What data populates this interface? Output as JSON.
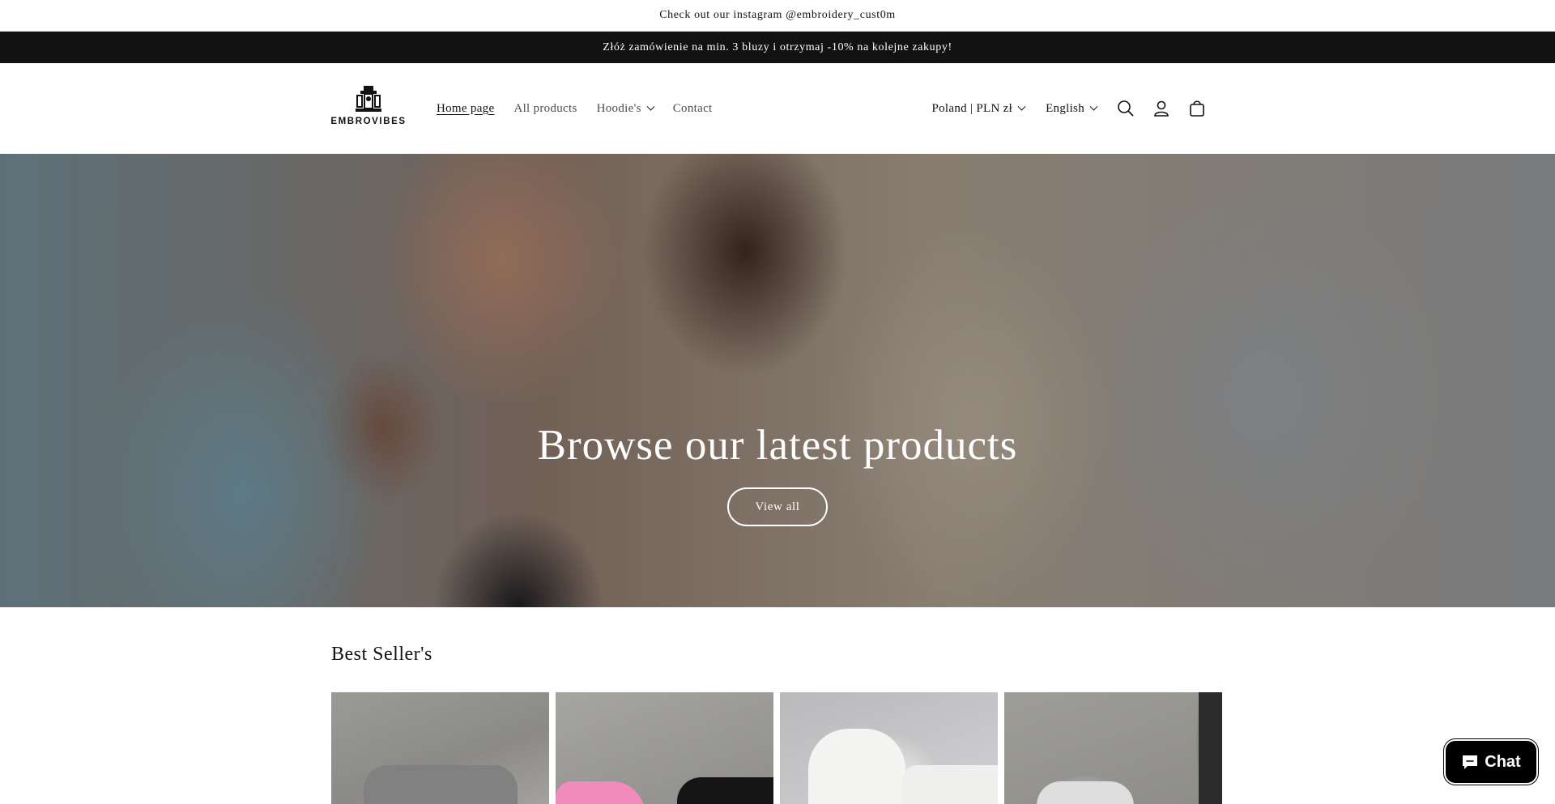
{
  "announcements": {
    "top": "Check out our instagram @embroidery_cust0m",
    "dark": "Złóż zamówienie na min. 3 bluzy i otrzymaj -10% na kolejne zakupy!"
  },
  "header": {
    "logo_text": "EMBROVIBES",
    "nav": [
      {
        "label": "Home page",
        "active": true
      },
      {
        "label": "All products"
      },
      {
        "label": "Hoodie's",
        "has_dropdown": true
      },
      {
        "label": "Contact"
      }
    ],
    "country_selector": "Poland | PLN zł",
    "language_selector": "English",
    "icons": [
      "search-icon",
      "account-icon",
      "cart-icon"
    ]
  },
  "hero": {
    "title": "Browse our latest products",
    "button_label": "View all"
  },
  "best_sellers": {
    "title": "Best Seller's"
  },
  "chat": {
    "label": "Chat"
  },
  "colors": {
    "announcement_dark": "#121212",
    "chat_button": "#000000",
    "text": "#121212"
  }
}
